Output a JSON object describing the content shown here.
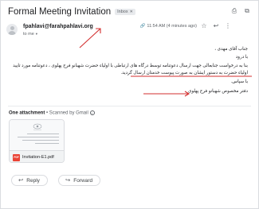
{
  "email": {
    "subject": "Formal Meeting Invitation",
    "label": "Inbox",
    "sender": "fpahlavi@farahpahlavi.org",
    "recipient": "to me",
    "timestamp": "11:54 AM (4 minutes ago)"
  },
  "body": {
    "greeting": "جناب آقای مهدی ،",
    "salutation": "با درود",
    "paragraph_line1": "بنا به درخواست جنابعالی جهت ارسال دعوتنامه توسط درگاه های ارتباطی با اولیاء حضرت شهبانو فرح پهلوی ، دعوتنامه مورد تایید",
    "paragraph_line2": "اولیاء حضرت به دستور ایشان به صورت پیوست خدمتان ارسال گردید.",
    "closing": "با سپاس.",
    "signature": "دفتر مخصوص شهبانو فرح پهلوی"
  },
  "attachments": {
    "count_label": "One attachment",
    "scan_label": "Scanned by Gmail",
    "items": [
      {
        "name": "Invitation-E1.pdf",
        "type_badge": "PDF"
      }
    ]
  },
  "actions": {
    "reply_label": "Reply",
    "forward_label": "Forward"
  },
  "colors": {
    "annotation_red": "#d32f2f",
    "pdf_red": "#ea4335"
  },
  "icons": {
    "print": "print-icon",
    "open_new_window": "open-new-window-icon",
    "star": "star-icon",
    "reply": "reply-icon",
    "more": "more-vert-icon",
    "attachment": "paperclip-icon",
    "forward": "forward-icon"
  }
}
